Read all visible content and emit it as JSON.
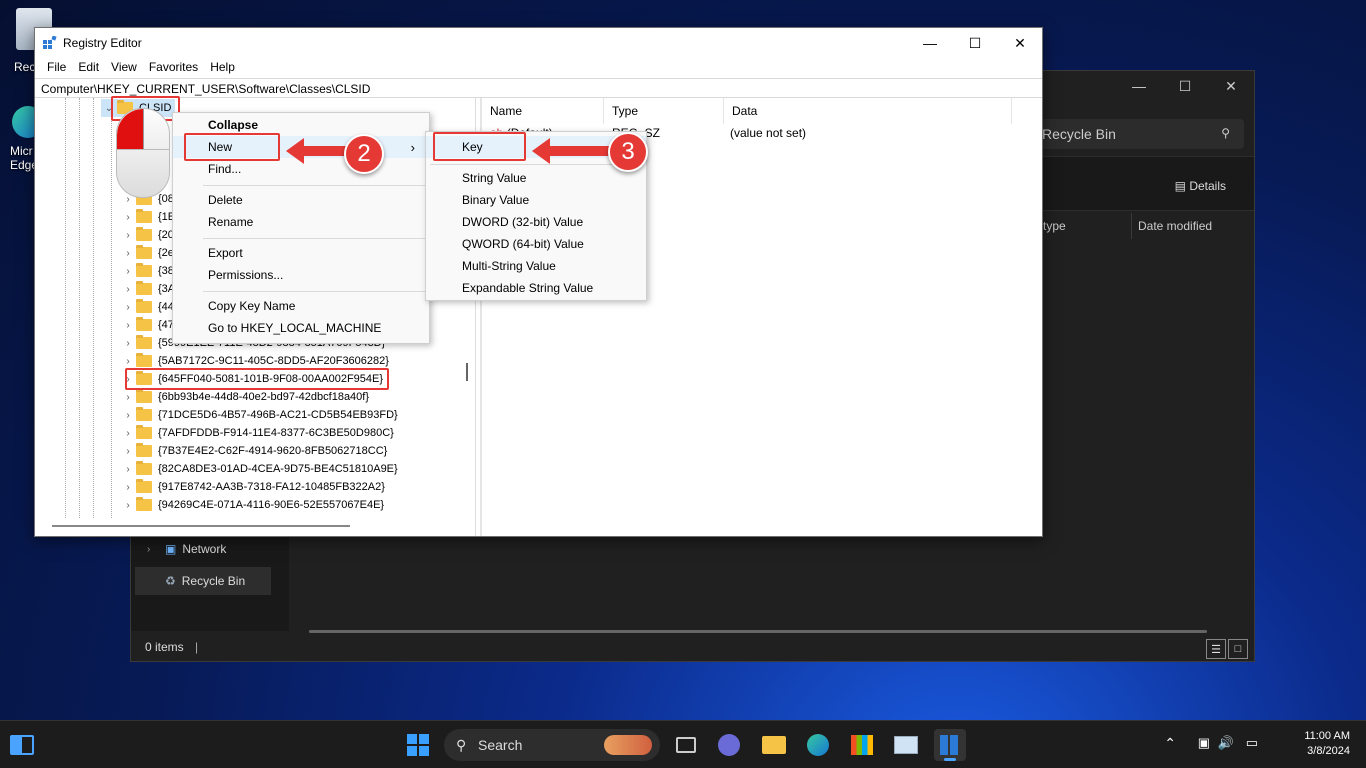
{
  "desktop": {
    "recycle_label": "Recyc",
    "edge_label_1": "Micr",
    "edge_label_2": "Edge"
  },
  "explorer": {
    "search_placeholder": "Recycle Bin",
    "details_label": "Details",
    "col_type": "type",
    "col_date": "Date modified",
    "nav_network": "Network",
    "nav_recycle": "Recycle Bin",
    "status": "0 items"
  },
  "regedit": {
    "title": "Registry Editor",
    "menu": [
      "File",
      "Edit",
      "View",
      "Favorites",
      "Help"
    ],
    "address": "Computer\\HKEY_CURRENT_USER\\Software\\Classes\\CLSID",
    "tree_selected": "CLSID",
    "tree": [
      "{08",
      "{1E",
      "{20",
      "{2e",
      "{38",
      "{3A",
      "{44",
      "{47",
      "{5999E1EE-711E-48D2-9884-851A709F543D}",
      "{5AB7172C-9C11-405C-8DD5-AF20F3606282}",
      "{645FF040-5081-101B-9F08-00AA002F954E}",
      "{6bb93b4e-44d8-40e2-bd97-42dbcf18a40f}",
      "{71DCE5D6-4B57-496B-AC21-CD5B54EB93FD}",
      "{7AFDFDDB-F914-11E4-8377-6C3BE50D980C}",
      "{7B37E4E2-C62F-4914-9620-8FB5062718CC}",
      "{82CA8DE3-01AD-4CEA-9D75-BE4C51810A9E}",
      "{917E8742-AA3B-7318-FA12-10485FB322A2}",
      "{94269C4E-071A-4116-90E6-52E557067E4E}"
    ],
    "columns": {
      "name": "Name",
      "type": "Type",
      "data": "Data"
    },
    "row": {
      "name": "(Default)",
      "type": "REG_SZ",
      "data": "(value not set)"
    }
  },
  "context_menu": {
    "collapse": "Collapse",
    "new": "New",
    "find": "Find...",
    "delete": "Delete",
    "rename": "Rename",
    "export": "Export",
    "permissions": "Permissions...",
    "copy_key": "Copy Key Name",
    "goto": "Go to HKEY_LOCAL_MACHINE"
  },
  "submenu": {
    "key": "Key",
    "string": "String Value",
    "binary": "Binary Value",
    "dword": "DWORD (32-bit) Value",
    "qword": "QWORD (64-bit) Value",
    "multi": "Multi-String Value",
    "expand": "Expandable String Value"
  },
  "badges": {
    "step2": "2",
    "step3": "3"
  },
  "taskbar": {
    "search_label": "Search",
    "time": "11:00 AM",
    "date": "3/8/2024"
  },
  "colors": {
    "accent_red": "#e53935",
    "folder": "#f5c446"
  }
}
